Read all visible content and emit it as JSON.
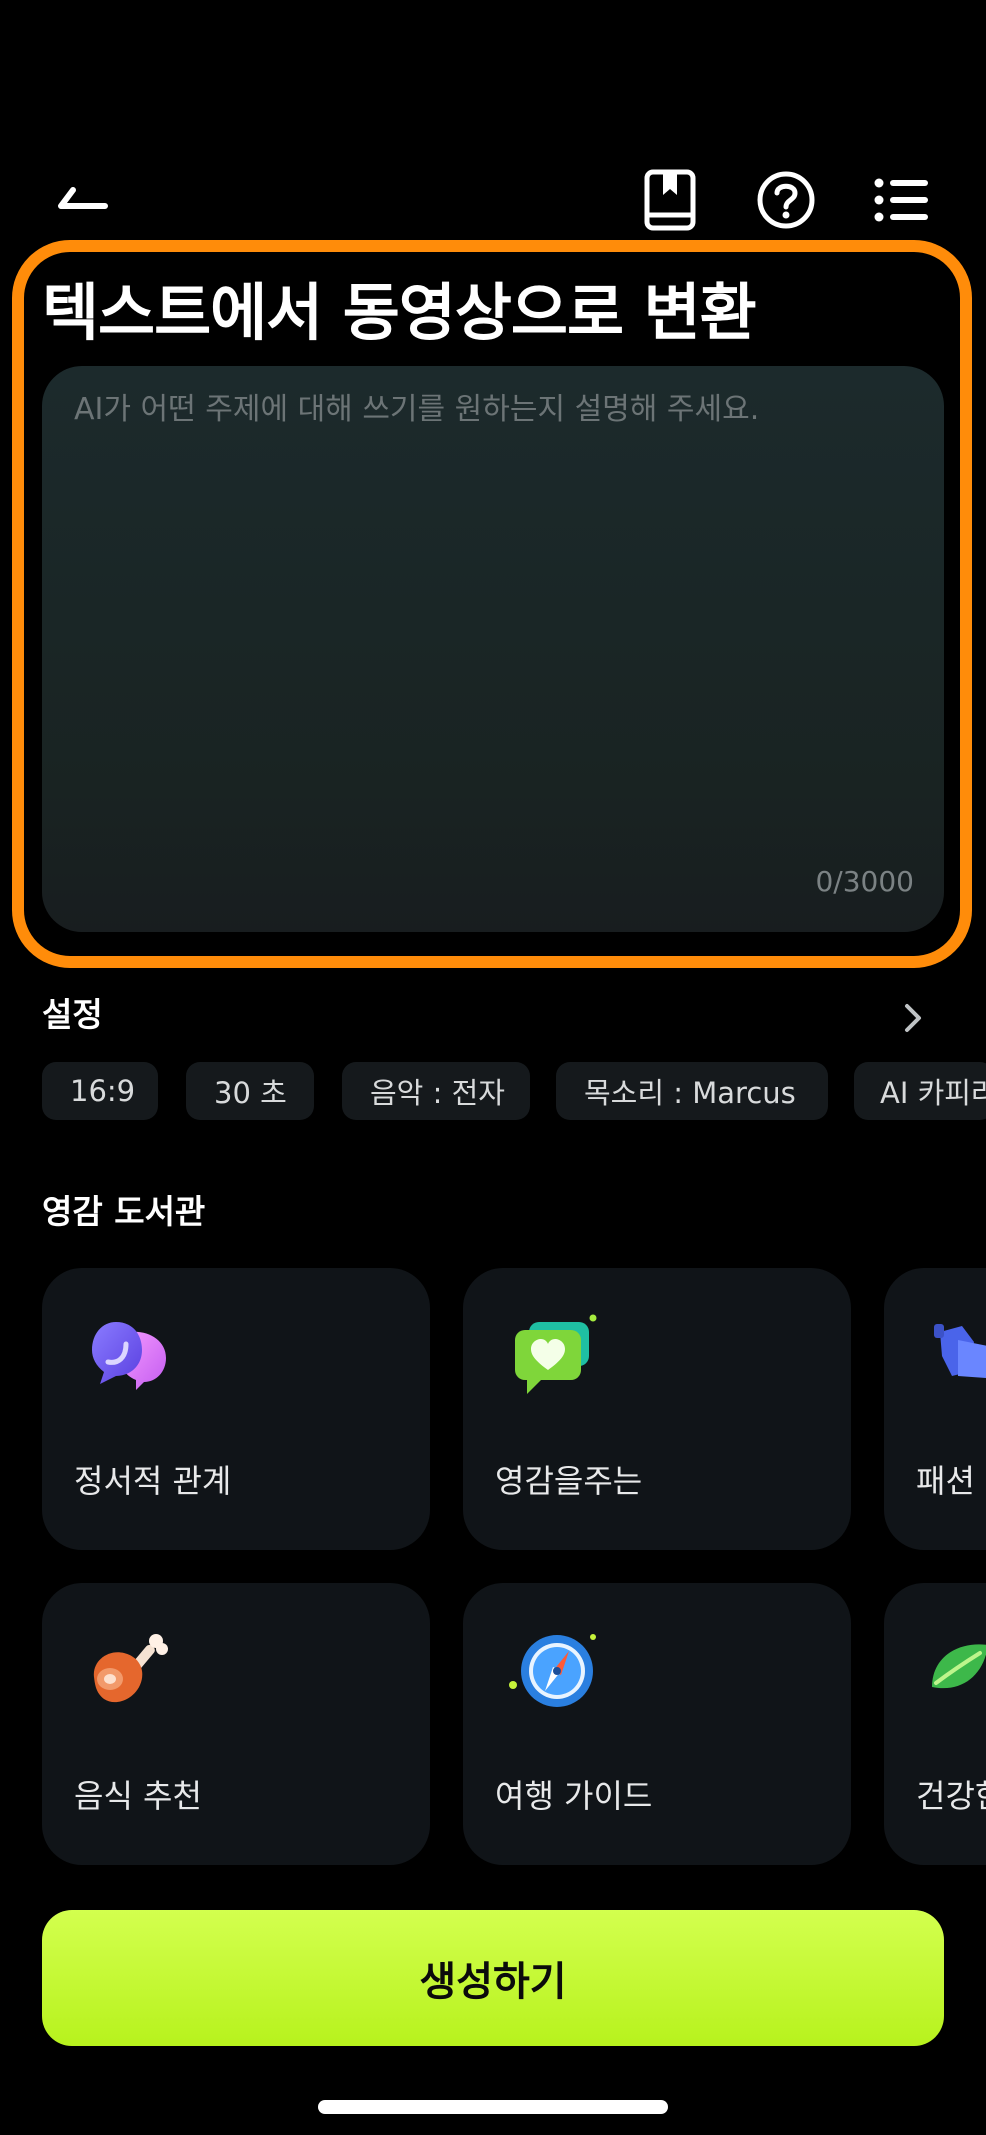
{
  "header": {
    "title": "텍스트에서 동영상으로 변환",
    "icons": [
      "back-icon",
      "book-icon",
      "help-icon",
      "list-icon"
    ]
  },
  "prompt": {
    "placeholder": "AI가 어떤 주제에 대해 쓰기를 원하는지 설명해 주세요.",
    "counter": "0/3000"
  },
  "settings": {
    "title": "설정",
    "chips": [
      "16:9",
      "30 초",
      "음악 : 전자",
      "목소리 : Marcus",
      "AI 카피라이팅"
    ]
  },
  "library": {
    "title": "영감 도서관",
    "cards": [
      {
        "label": "정서적 관계",
        "icon": "chat-bubbles-icon"
      },
      {
        "label": "영감을주는",
        "icon": "heart-message-icon"
      },
      {
        "label": "패션 스타일",
        "icon": "fashion-icon"
      },
      {
        "label": "음식 추천",
        "icon": "meat-icon"
      },
      {
        "label": "여행 가이드",
        "icon": "compass-icon"
      },
      {
        "label": "건강한 생활",
        "icon": "leaf-icon"
      }
    ]
  },
  "generate": {
    "label": "생성하기"
  },
  "colors": {
    "accent": "#b7f21d",
    "highlight": "#ff8c0a",
    "background": "#000000"
  }
}
